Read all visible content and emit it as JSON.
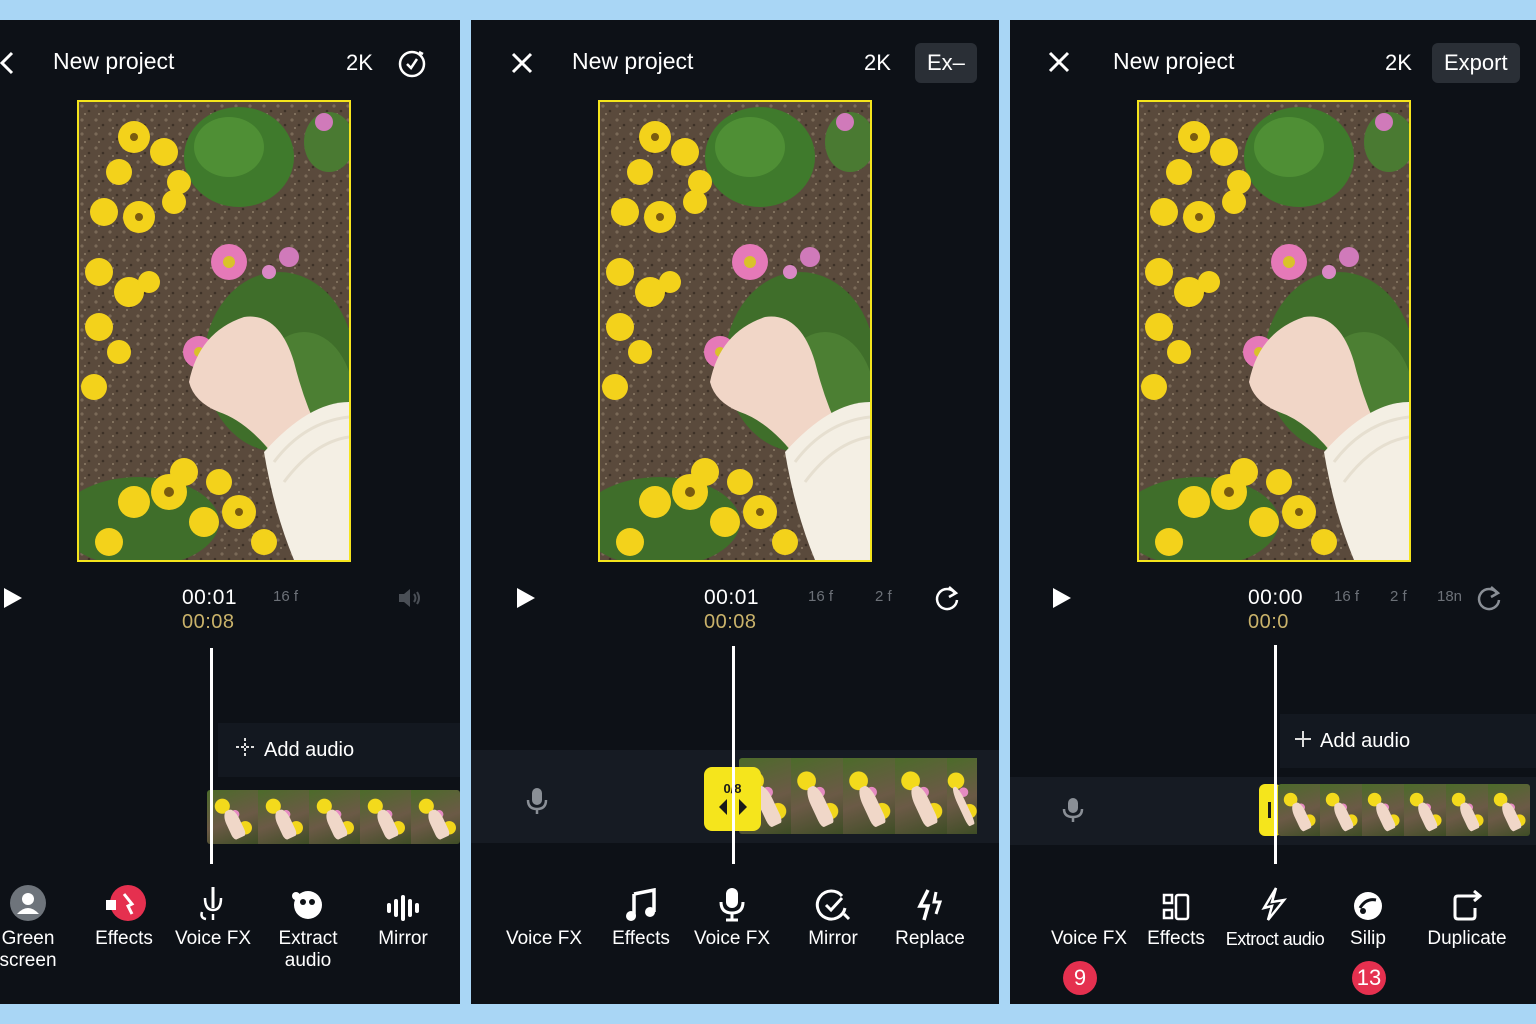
{
  "panels": [
    {
      "title": "New project",
      "resolution": "2K",
      "time_current": "00:01",
      "time_total": "00:08",
      "frame_labels": [
        "16 f"
      ],
      "add_audio_label": "Add audio",
      "tools": [
        {
          "label": "Green screen",
          "icon": "person-icon"
        },
        {
          "label": "Effects",
          "icon": "effects-icon"
        },
        {
          "label": "Voice FX",
          "icon": "voice-fx-icon"
        },
        {
          "label": "Extract audio",
          "icon": "extract-audio-icon"
        },
        {
          "label": "Mirror",
          "icon": "waveform-icon"
        }
      ]
    },
    {
      "title": "New project",
      "resolution": "2K",
      "export_label": "Ex–",
      "time_current": "00:01",
      "time_total": "00:08",
      "frame_labels": [
        "16 f",
        "2 f"
      ],
      "clip_handle_label": "0/8",
      "tools": [
        {
          "label": "Voice FX",
          "icon": "none"
        },
        {
          "label": "Effects",
          "icon": "music-note-icon"
        },
        {
          "label": "Voice FX",
          "icon": "microphone-icon"
        },
        {
          "label": "Mirror",
          "icon": "mirror-check-icon"
        },
        {
          "label": "Replace",
          "icon": "replace-icon"
        }
      ]
    },
    {
      "title": "New project",
      "resolution": "2K",
      "export_label": "Export",
      "time_current": "00:00",
      "time_total": "00:0",
      "frame_labels": [
        "16 f",
        "2 f",
        "18n"
      ],
      "add_audio_label": "Add audio",
      "tools": [
        {
          "label": "Voice FX",
          "icon": "none",
          "badge": "9"
        },
        {
          "label": "Effects",
          "icon": "effects-square-icon"
        },
        {
          "label": "Extroct audio",
          "icon": "sparkle-icon"
        },
        {
          "label": "Silip",
          "icon": "slip-icon",
          "badge": "13"
        },
        {
          "label": "Duplicate",
          "icon": "duplicate-icon"
        }
      ]
    }
  ],
  "colors": {
    "background": "#a9d6f5",
    "panel": "#0d1117",
    "accent_yellow": "#f5e51c",
    "badge_red": "#e5304f",
    "time_total": "#c9b26a"
  }
}
